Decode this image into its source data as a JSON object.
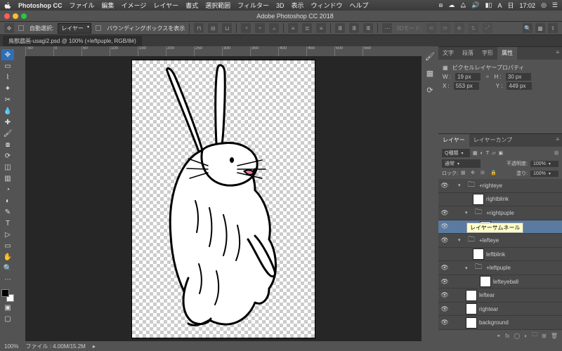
{
  "mac_menu": {
    "app": "Photoshop CC",
    "items": [
      "ファイル",
      "編集",
      "イメージ",
      "レイヤー",
      "書式",
      "選択範囲",
      "フィルター",
      "3D",
      "表示",
      "ウィンドウ",
      "ヘルプ"
    ],
    "time": "17:02",
    "day": "日"
  },
  "app_title": "Adobe Photoshop CC 2018",
  "options_bar": {
    "auto_select_label": "自動選択:",
    "auto_select_value": "レイヤー",
    "show_bbox": "バウンディングボックスを表示",
    "mode_label": "3Dモード:"
  },
  "document": {
    "tab": "鳥獣戯画-usagi2.psd @ 100% (+leftpuple, RGB/8#)"
  },
  "ruler_marks": [
    "-50",
    "0",
    "50",
    "100",
    "150",
    "200",
    "250",
    "300",
    "350",
    "400",
    "450",
    "500",
    "550"
  ],
  "status": {
    "zoom": "100%",
    "info": "ファイル : 4.00M/15.2M"
  },
  "panels": {
    "props": {
      "tabs": [
        "文字",
        "段落",
        "字形",
        "属性"
      ],
      "active": 3,
      "title": "ピクセルレイヤープロパティ",
      "w_label": "W :",
      "w": "19 px",
      "h_label": "H :",
      "h": "30 px",
      "x_label": "X :",
      "x": "553 px",
      "y_label": "Y :",
      "y": "449 px"
    },
    "layers": {
      "tabs": [
        "レイヤー",
        "レイヤーカンプ"
      ],
      "active": 0,
      "kind_label": "Q種類",
      "blend": "通常",
      "opacity_label": "不透明度:",
      "opacity": "100%",
      "lock_label": "ロック:",
      "fill_label": "塗り:",
      "fill": "100%",
      "tooltip": "レイヤーサムネール",
      "items": [
        {
          "indent": 1,
          "type": "group",
          "open": true,
          "name": "+righteye",
          "vis": true
        },
        {
          "indent": 2,
          "type": "layer",
          "name": "rightblink",
          "vis": false
        },
        {
          "indent": 2,
          "type": "group",
          "open": true,
          "name": "+rightpuple",
          "vis": true
        },
        {
          "indent": 3,
          "type": "layer",
          "name": "",
          "vis": true,
          "sel": true,
          "tooltip": true
        },
        {
          "indent": 1,
          "type": "group",
          "open": true,
          "name": "+lefteye",
          "vis": true
        },
        {
          "indent": 2,
          "type": "layer",
          "name": "leftblink",
          "vis": false
        },
        {
          "indent": 2,
          "type": "group",
          "open": true,
          "name": "+leftpuple",
          "vis": true
        },
        {
          "indent": 3,
          "type": "layer",
          "name": "lefteyeball",
          "vis": true
        },
        {
          "indent": 1,
          "type": "layer",
          "name": "leftear",
          "vis": true
        },
        {
          "indent": 1,
          "type": "layer",
          "name": "rightear",
          "vis": true
        },
        {
          "indent": 1,
          "type": "layer",
          "name": "background",
          "vis": true
        }
      ]
    }
  }
}
